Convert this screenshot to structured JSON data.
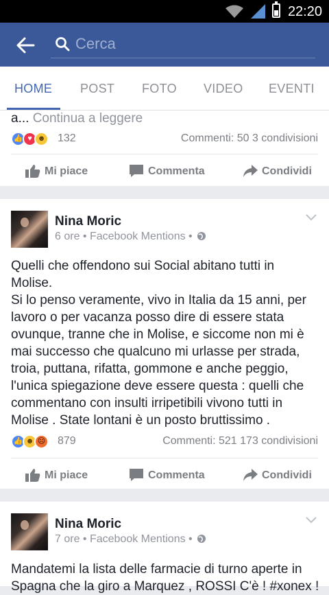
{
  "status": {
    "time": "22:20"
  },
  "search": {
    "placeholder": "Cerca",
    "value": ""
  },
  "tabs": [
    {
      "label": "HOME",
      "active": true
    },
    {
      "label": "POST"
    },
    {
      "label": "FOTO"
    },
    {
      "label": "VIDEO"
    },
    {
      "label": "EVENTI"
    }
  ],
  "colors": {
    "brand": "#3b5998",
    "accent": "#4267b2"
  },
  "actions": {
    "like": "Mi piace",
    "comment": "Commenta",
    "share": "Condividi"
  },
  "posts": [
    {
      "truncated_prefix": "a...",
      "continue_label": "Continua a leggere",
      "reactions": [
        "like",
        "love",
        "haha"
      ],
      "reaction_count": "132",
      "stats": "Commenti: 50 3 condivisioni"
    },
    {
      "author": "Nina Moric",
      "meta": "6 ore • Facebook Mentions •",
      "text": "Quelli che offendono sui Social abitano tutti in\nMolise.\nSi lo penso veramente, vivo in Italia da 15 anni, per\nlavoro o per vacanza posso dire di essere stata\novunque, tranne che in Molise, e siccome non mi è\nmai successo che qualcuno mi urlasse per strada,\ntroia, puttana, rifatta, gommone e anche peggio,\nl'unica spiegazione deve essere questa : quelli che\ncommentano con insulti irripetibili vivono tutti in\nMolise . State lontani è un posto bruttissimo .",
      "reactions": [
        "like",
        "haha",
        "angry"
      ],
      "reaction_count": "879",
      "stats": "Commenti: 521 173 condivisioni"
    },
    {
      "author": "Nina Moric",
      "meta": "7 ore • Facebook Mentions •",
      "text": "Mandatemi la lista delle farmacie di turno aperte in\nSpagna che la giro a Marquez , ROSSI C'è ! #xonex !"
    }
  ]
}
